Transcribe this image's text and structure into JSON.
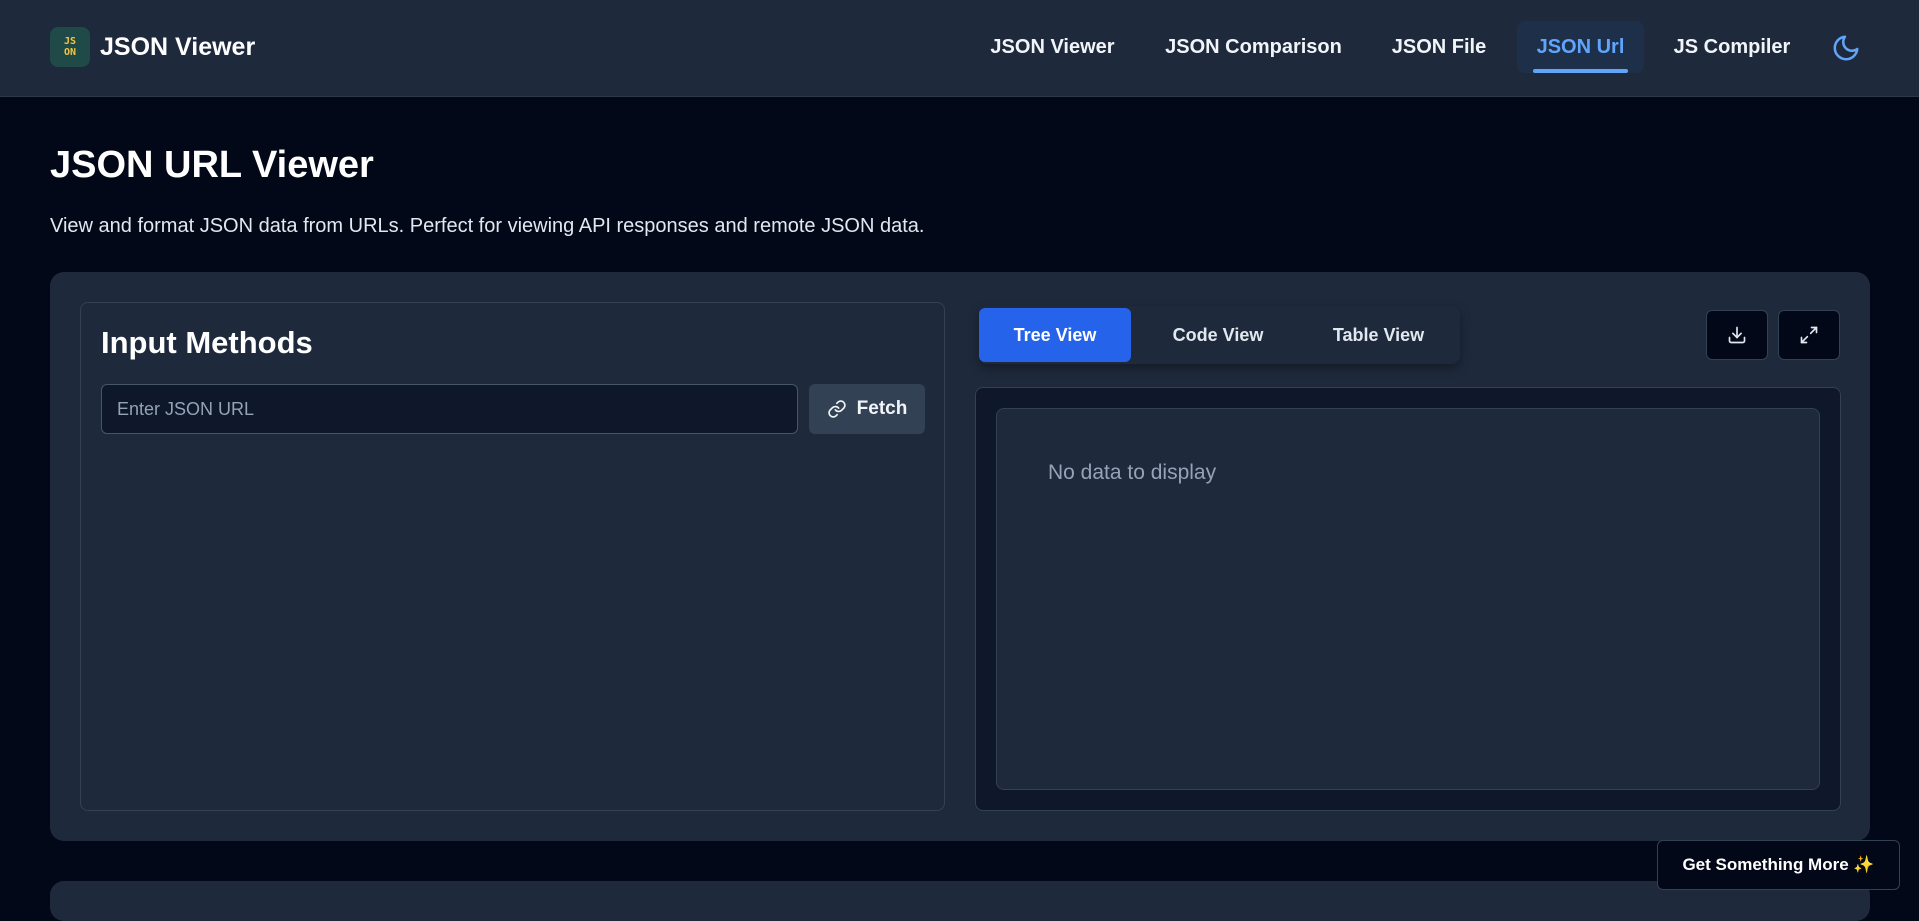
{
  "header": {
    "brand_logo_top": "JS",
    "brand_logo_bottom": "ON",
    "brand_title": "JSON Viewer",
    "nav": [
      {
        "label": "JSON Viewer",
        "active": false
      },
      {
        "label": "JSON Comparison",
        "active": false
      },
      {
        "label": "JSON File",
        "active": false
      },
      {
        "label": "JSON Url",
        "active": true
      },
      {
        "label": "JS Compiler",
        "active": false
      }
    ],
    "theme_icon": "moon-icon"
  },
  "page": {
    "title": "JSON URL Viewer",
    "description": "View and format JSON data from URLs. Perfect for viewing API responses and remote JSON data."
  },
  "input_panel": {
    "title": "Input Methods",
    "url_placeholder": "Enter JSON URL",
    "url_value": "",
    "fetch_label": "Fetch",
    "fetch_icon": "link-icon"
  },
  "viewer": {
    "tabs": [
      {
        "label": "Tree View",
        "active": true
      },
      {
        "label": "Code View",
        "active": false
      },
      {
        "label": "Table View",
        "active": false
      }
    ],
    "actions": [
      "download-icon",
      "expand-icon"
    ],
    "empty_message": "No data to display"
  },
  "promo": {
    "label": "Get Something More ✨"
  },
  "colors": {
    "background": "#020817",
    "surface": "#1e293b",
    "accent": "#2563eb",
    "active_nav": "#60a5fa"
  }
}
